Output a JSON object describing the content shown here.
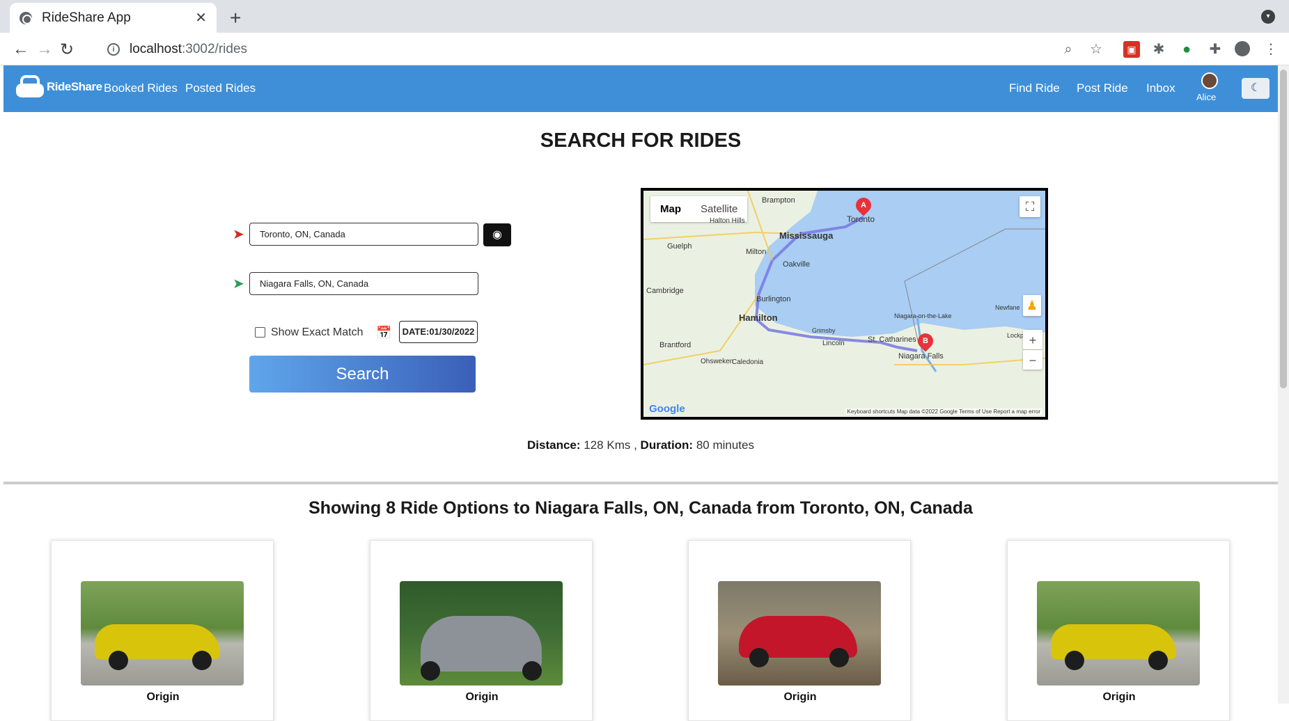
{
  "browser": {
    "tab_title": "RideShare App",
    "url_host": "localhost",
    "url_path": ":3002/rides",
    "new_tab_glyph": "+",
    "close_tab_glyph": "✕"
  },
  "navbar": {
    "brand": "RideShare",
    "left_links": [
      "Booked Rides",
      "Posted Rides"
    ],
    "right_links": [
      "Find Ride",
      "Post Ride",
      "Inbox"
    ],
    "user_name": "Alice",
    "bg_color": "#3e8fd8"
  },
  "search": {
    "heading": "SEARCH FOR RIDES",
    "origin_value": "Toronto, ON, Canada",
    "destination_value": "Niagara Falls, ON, Canada",
    "exact_match_label": "Show Exact Match",
    "exact_match_checked": false,
    "date_value": "DATE:01/30/2022",
    "search_button": "Search"
  },
  "map": {
    "tabs": [
      "Map",
      "Satellite"
    ],
    "active_tab": "Map",
    "labels": {
      "brampton": "Brampton",
      "toronto": "Toronto",
      "halton_hills": "Halton Hills",
      "mississauga": "Mississauga",
      "guelph": "Guelph",
      "milton": "Milton",
      "oakville": "Oakville",
      "cambridge": "Cambridge",
      "burlington": "Burlington",
      "hamilton": "Hamilton",
      "niagara_on_the_lake": "Niagara-on-the-Lake",
      "newfane": "Newfane",
      "grimsby": "Grimsby",
      "st_catharines": "St. Catharines",
      "lockport": "Lockport",
      "brantford": "Brantford",
      "lincoln": "Lincoln",
      "niagara_falls": "Niagara Falls",
      "ohsweken": "Ohsweken",
      "caledonia": "Caledonia"
    },
    "marker_a": "A",
    "marker_b": "B",
    "google_logo": "Google",
    "footer": "Keyboard shortcuts   Map data ©2022 Google   Terms of Use   Report a map error"
  },
  "summary": {
    "distance_label": "Distance:",
    "distance_value": "128 Kms ,",
    "duration_label": "Duration:",
    "duration_value": "80 minutes"
  },
  "results": {
    "title": "Showing 8 Ride Options to Niagara Falls, ON, Canada from Toronto, ON, Canada",
    "cards": [
      {
        "photo": "yellow sports car",
        "origin_label": "Origin"
      },
      {
        "photo": "gray sports car",
        "origin_label": "Origin"
      },
      {
        "photo": "red sports car",
        "origin_label": "Origin"
      },
      {
        "photo": "yellow sports car",
        "origin_label": "Origin"
      }
    ]
  }
}
